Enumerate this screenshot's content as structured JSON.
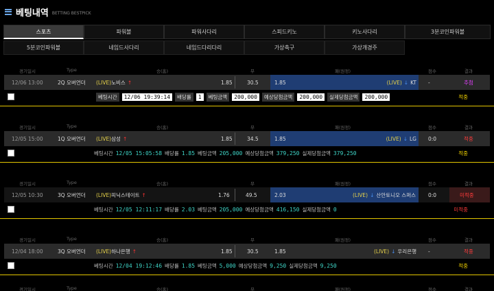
{
  "header": {
    "title": "베팅내역",
    "subtitle": "BETTING BESTPICK"
  },
  "tabs_row1": [
    "스포츠",
    "파워볼",
    "파워사다리",
    "스피드키노",
    "키노사다리",
    "3분코인파워볼"
  ],
  "tabs_row2": [
    "5분코인파워볼",
    "네임드사다리",
    "네임드다리다리",
    "가상축구",
    "가상개경주"
  ],
  "columns": {
    "time": "경기일시",
    "type": "Type",
    "home": "승(홈)",
    "draw": "무",
    "away": "패(원정)",
    "score": "점수",
    "result": "결과"
  },
  "bets": [
    {
      "time": "12/06 13:00",
      "type": "2Q 오버언더",
      "home_live": "(LIVE)",
      "home": "노비스",
      "home_arrow": "↑",
      "home_odds": "1.85",
      "draw": "30.5",
      "away_odds": "1.85",
      "away_live": "(LIVE)",
      "away_arrow": "↓",
      "away": "KT",
      "score": "-",
      "result": "추첨",
      "bet_time_label": "베팅시간",
      "bet_time": "12/06 19:39:14",
      "odds_label": "배당률",
      "odds": "1",
      "amount_label": "베팅금액",
      "amount": "200,000",
      "expected_label": "예상당첨금액",
      "expected": "200,000",
      "actual_label": "실제당첨금액",
      "actual": "200,000",
      "status": "적중"
    },
    {
      "time": "12/05 15:00",
      "type": "1Q 오버언더",
      "home_live": "(LIVE)",
      "home": "삼성",
      "home_arrow": "↑",
      "home_odds": "1.85",
      "draw": "34.5",
      "away_odds": "1.85",
      "away_live": "(LIVE)",
      "away_arrow": "↓",
      "away": "LG",
      "score": "0:0",
      "result": "적중",
      "bet_time_label": "베팅시간",
      "bet_time": "12/05 15:05:58",
      "odds_label": "배당률",
      "odds": "1.85",
      "amount_label": "베팅금액",
      "amount": "205,000",
      "expected_label": "예상당첨금액",
      "expected": "379,250",
      "actual_label": "실제당첨금액",
      "actual": "379,250",
      "status": "적중"
    },
    {
      "time": "12/05 10:30",
      "type": "3Q 오버언더",
      "home_live": "(LIVE)",
      "home": "피닉스테이트",
      "home_arrow": "↑",
      "home_odds": "1.76",
      "draw": "49.5",
      "away_odds": "2.03",
      "away_live": "(LIVE)",
      "away_arrow": "↓",
      "away": "산안토니오 스퍼스",
      "score": "0:0",
      "result": "미적중",
      "bet_time_label": "베팅시간",
      "bet_time": "12/05 12:11:17",
      "odds_label": "배당률",
      "odds": "2.03",
      "amount_label": "베팅금액",
      "amount": "205,000",
      "expected_label": "예상당첨금액",
      "expected": "416,150",
      "actual_label": "실제당첨금액",
      "actual": "0",
      "status": "미적중"
    },
    {
      "time": "12/04 18:00",
      "type": "3Q 오버언더",
      "home_live": "(LIVE)",
      "home": "하나은행",
      "home_arrow": "↑",
      "home_odds": "1.85",
      "draw": "30.5",
      "away_odds": "1.85",
      "away_live": "(LIVE)",
      "away_arrow": "↓",
      "away": "우리은행",
      "score": "-",
      "result": "적중",
      "bet_time_label": "베팅시간",
      "bet_time": "12/04 19:12:46",
      "odds_label": "배당률",
      "odds": "1.85",
      "amount_label": "베팅금액",
      "amount": "5,000",
      "expected_label": "예상당첨금액",
      "expected": "9,250",
      "actual_label": "실제당첨금액",
      "actual": "9,250",
      "status": "적중"
    }
  ],
  "colors": {
    "accent_blue": "#1f3d73",
    "yellow": "#f2d200",
    "pink": "#e040fb",
    "red": "#ff3b3b"
  }
}
